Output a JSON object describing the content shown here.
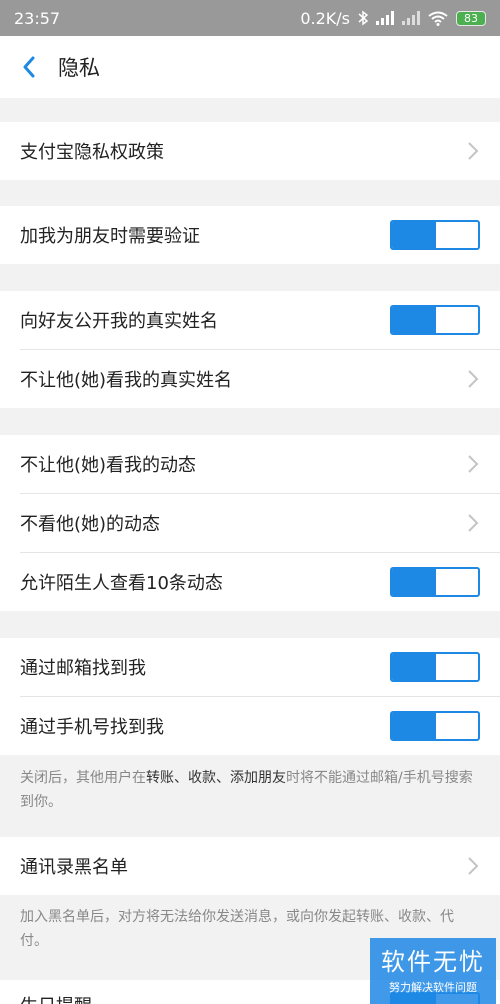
{
  "status_bar": {
    "time": "23:57",
    "network_speed": "0.2K/s",
    "battery_level": "83",
    "icons": [
      "bluetooth-icon",
      "signal-icon",
      "signal-icon",
      "wifi-icon",
      "battery-icon"
    ]
  },
  "nav": {
    "title": "隐私",
    "back_icon": "chevron-left-icon"
  },
  "rows": {
    "alipay_privacy_policy": "支付宝隐私权政策",
    "friend_verification": "加我为朋友时需要验证",
    "show_real_name": "向好友公开我的真实姓名",
    "hide_real_name": "不让他(她)看我的真实姓名",
    "hide_my_moments": "不让他(她)看我的动态",
    "hide_their_moments": "不看他(她)的动态",
    "stranger_view": "允许陌生人查看10条动态",
    "find_by_email": "通过邮箱找到我",
    "find_by_phone": "通过手机号找到我",
    "contacts_blacklist": "通讯录黑名单",
    "birthday_reminder": "生日提醒"
  },
  "toggles": {
    "friend_verification": true,
    "show_real_name": true,
    "stranger_view": true,
    "find_by_email": true,
    "find_by_phone": true,
    "birthday_reminder": true
  },
  "notes": {
    "search_note_pre": "关闭后，其他用户在",
    "search_note_bold": "转账、收款、添加朋友",
    "search_note_post": "时将不能通过邮箱/手机号搜索到你。",
    "blacklist_note": "加入黑名单后，对方将无法给你发送消息，或向你发起转账、收款、代付。"
  },
  "watermark": {
    "main": "软件无忧",
    "sub": "努力解决软件问题"
  },
  "colors": {
    "accent": "#1e88e5",
    "status_bar": "#999999",
    "background": "#f2f2f2"
  }
}
